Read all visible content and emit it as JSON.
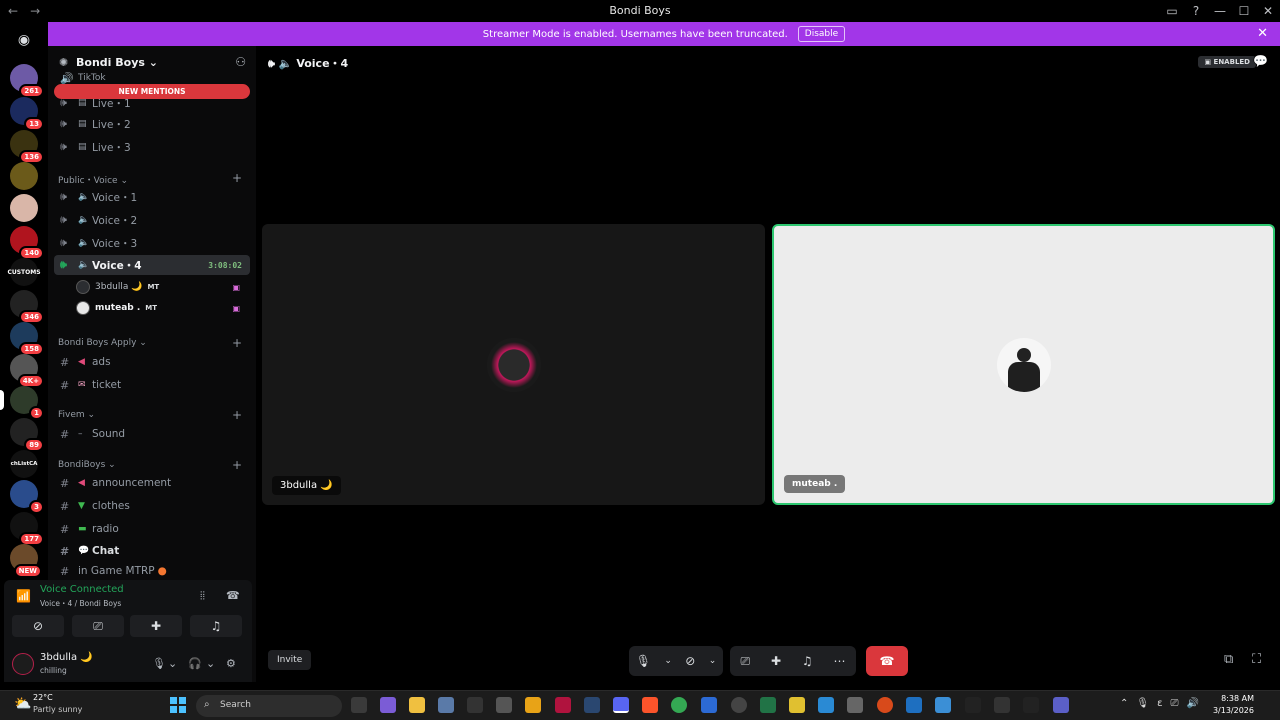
{
  "window": {
    "title": "Bondi Boys",
    "controls": [
      "▭",
      "?",
      "—",
      "☐",
      "✕"
    ]
  },
  "banner": {
    "text": "Streamer Mode is enabled. Usernames have been truncated.",
    "disable_label": "Disable",
    "color": "#a236e8"
  },
  "servers": {
    "badges": [
      "261",
      "13",
      "136",
      "140",
      "346",
      "158",
      "4K+",
      "1",
      "89",
      "3",
      "177",
      "NEW"
    ],
    "labels": [
      "CUSTOMS",
      "chListCA"
    ]
  },
  "sidebar": {
    "guild_name": "Bondi Boys",
    "new_mentions": "NEW MENTIONS",
    "partial_top": "TikTok",
    "live_channels": [
      "Live・1",
      "Live・2",
      "Live・3"
    ],
    "public_voice": {
      "category": "Public・Voice",
      "channels": [
        "Voice・1",
        "Voice・2",
        "Voice・3",
        "Voice・4"
      ],
      "active_timer": "3:08:02",
      "users": [
        {
          "name": "3bdulla 🌙",
          "tag": "MT"
        },
        {
          "name": "muteab .",
          "tag": "MT"
        }
      ]
    },
    "apply": {
      "category": "Bondi Boys Apply",
      "channels": [
        "ads",
        "ticket"
      ]
    },
    "fivem": {
      "category": "Fivem",
      "channels": [
        "Sound"
      ]
    },
    "bondi": {
      "category": "BondiBoys",
      "channels": [
        "announcement",
        "clothes",
        "radio",
        "Chat",
        "in Game MTRP"
      ]
    }
  },
  "voice_panel": {
    "status": "Voice Connected",
    "location": "Voice・4 / Bondi Boys"
  },
  "user": {
    "name": "3bdulla 🌙",
    "status": "chilling"
  },
  "stage": {
    "title": "Voice・4",
    "streamer_badge": "ENABLED",
    "tiles": [
      {
        "name": "3bdulla 🌙"
      },
      {
        "name": "muteab ."
      }
    ],
    "invite_label": "Invite",
    "speaking_color": "#2dc770"
  },
  "taskbar": {
    "weather_temp": "22°C",
    "weather_desc": "Partly sunny",
    "search_label": "Search",
    "time": "8:38 AM",
    "date": "3/13/2026"
  }
}
